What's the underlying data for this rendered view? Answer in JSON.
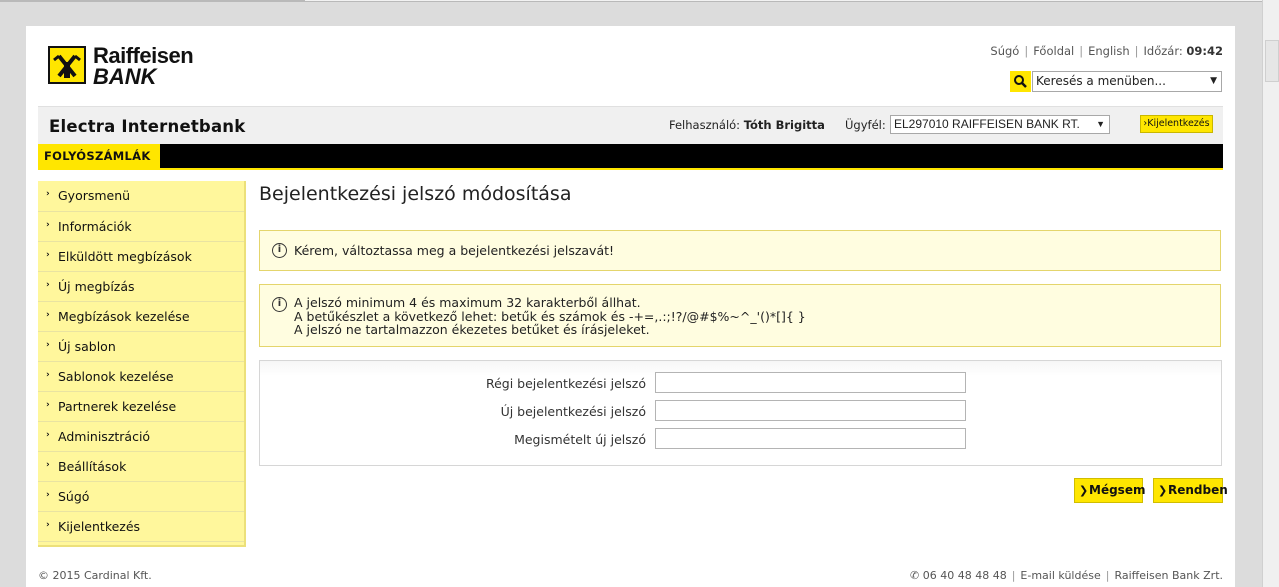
{
  "header": {
    "logo_line1": "Raiffeisen",
    "logo_line2": "BANK",
    "links": [
      "Súgó",
      "Főoldal",
      "English"
    ],
    "timer_label": "Időzár:",
    "timer_value": "09:42",
    "search_placeholder": "Keresés a menüben..."
  },
  "bar": {
    "app_name": "Electra Internetbank",
    "user_label": "Felhasználó:",
    "user_name": "Tóth Brigitta",
    "client_label": "Ügyfél:",
    "client_value": "EL297010 RAIFFEISEN BANK RT.",
    "logout_label": "Kijelentkezés"
  },
  "tab": {
    "label": "FOLYÓSZÁMLÁK"
  },
  "sidebar": {
    "items": [
      {
        "label": "Gyorsmenü"
      },
      {
        "label": "Információk"
      },
      {
        "label": "Elküldött megbízások"
      },
      {
        "label": "Új megbízás"
      },
      {
        "label": "Megbízások kezelése"
      },
      {
        "label": "Új sablon"
      },
      {
        "label": "Sablonok kezelése"
      },
      {
        "label": "Partnerek kezelése"
      },
      {
        "label": "Adminisztráció"
      },
      {
        "label": "Beállítások"
      },
      {
        "label": "Súgó"
      },
      {
        "label": "Kijelentkezés"
      }
    ]
  },
  "main": {
    "title": "Bejelentkezési jelszó módosítása",
    "notice1": "Kérem, változtassa meg a bejelentkezési jelszavát!",
    "notice2_lines": [
      "A jelszó minimum 4 és maximum 32 karakterből állhat.",
      "A betűkészlet a következő lehet: betűk és számok és -+=,.:;!?/@#$%~^_'()*[]{ }",
      "A jelszó ne tartalmazzon ékezetes betűket és írásjeleket."
    ],
    "fields": [
      {
        "label": "Régi bejelentkezési jelszó",
        "value": ""
      },
      {
        "label": "Új bejelentkezési jelszó",
        "value": ""
      },
      {
        "label": "Megismételt új jelszó",
        "value": ""
      }
    ],
    "cancel_label": "Mégsem",
    "ok_label": "Rendben"
  },
  "footer": {
    "copyright": "© 2015 Cardinal Kft.",
    "phone": "06 40 48 48 48",
    "email": "E-mail küldése",
    "company": "Raiffeisen Bank Zrt."
  },
  "colors": {
    "accent": "#ffe600",
    "sidebar_bg": "#fff79c",
    "notice_bg": "#fffde0",
    "black_bar": "#000000"
  },
  "icons": [
    "raiffeisen-logo-icon",
    "search-icon",
    "info-icon",
    "chevron-right-icon",
    "phone-icon"
  ]
}
